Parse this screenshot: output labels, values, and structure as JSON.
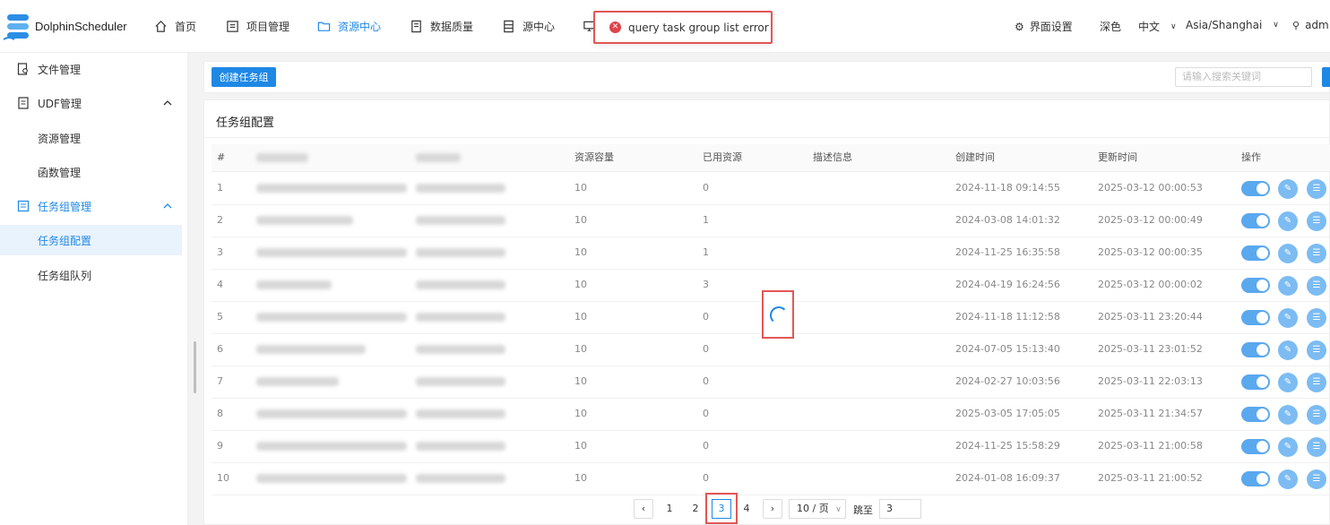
{
  "header": {
    "brand": "DolphinScheduler",
    "nav": [
      {
        "label": "首页",
        "icon": "home-icon"
      },
      {
        "label": "项目管理",
        "icon": "project-icon"
      },
      {
        "label": "资源中心",
        "icon": "folder-icon",
        "active": true
      },
      {
        "label": "数据质量",
        "icon": "quality-icon"
      },
      {
        "label": "源中心",
        "icon": "datasource-icon"
      },
      {
        "label": "",
        "icon": "monitor-icon"
      }
    ],
    "toast": {
      "text": "query task group list error"
    },
    "settings_label": "界面设置",
    "theme_label": "深色",
    "lang_label": "中文",
    "timezone_label": "Asia/Shanghai",
    "user_label": "adm"
  },
  "sidebar": {
    "items": [
      {
        "label": "文件管理"
      },
      {
        "label": "UDF管理"
      },
      {
        "label": "资源管理"
      },
      {
        "label": "函数管理"
      },
      {
        "label": "任务组管理"
      },
      {
        "label": "任务组配置"
      },
      {
        "label": "任务组队列"
      }
    ]
  },
  "toolbar": {
    "create_label": "创建任务组",
    "search_placeholder": "请输入搜索关键词"
  },
  "card": {
    "title": "任务组配置"
  },
  "table": {
    "headers": [
      "#",
      "",
      "",
      "资源容量",
      "已用资源",
      "描述信息",
      "创建时间",
      "更新时间",
      "操作"
    ],
    "rows": [
      {
        "idx": "1",
        "capacity": "10",
        "used": "0",
        "created": "2024-11-18 09:14:55",
        "updated": "2025-03-12 00:00:53"
      },
      {
        "idx": "2",
        "capacity": "10",
        "used": "1",
        "created": "2024-03-08 14:01:32",
        "updated": "2025-03-12 00:00:49"
      },
      {
        "idx": "3",
        "capacity": "10",
        "used": "1",
        "created": "2024-11-25 16:35:58",
        "updated": "2025-03-12 00:00:35"
      },
      {
        "idx": "4",
        "capacity": "10",
        "used": "3",
        "created": "2024-04-19 16:24:56",
        "updated": "2025-03-12 00:00:02"
      },
      {
        "idx": "5",
        "capacity": "10",
        "used": "0",
        "created": "2024-11-18 11:12:58",
        "updated": "2025-03-11 23:20:44"
      },
      {
        "idx": "6",
        "capacity": "10",
        "used": "0",
        "created": "2024-07-05 15:13:40",
        "updated": "2025-03-11 23:01:52"
      },
      {
        "idx": "7",
        "capacity": "10",
        "used": "0",
        "created": "2024-02-27 10:03:56",
        "updated": "2025-03-11 22:03:13"
      },
      {
        "idx": "8",
        "capacity": "10",
        "used": "0",
        "created": "2025-03-05 17:05:05",
        "updated": "2025-03-11 21:34:57"
      },
      {
        "idx": "9",
        "capacity": "10",
        "used": "0",
        "created": "2024-11-25 15:58:29",
        "updated": "2025-03-11 21:00:58"
      },
      {
        "idx": "10",
        "capacity": "10",
        "used": "0",
        "created": "2024-01-08 16:09:37",
        "updated": "2025-03-11 21:00:52"
      }
    ]
  },
  "pagination": {
    "pages": [
      "1",
      "2",
      "3",
      "4"
    ],
    "current": "3",
    "page_size": "10 / 页",
    "jump_label": "跳至",
    "jump_value": "3"
  },
  "colors": {
    "primary": "#1e88e5",
    "error": "#e0434a",
    "highlight": "#e35656"
  }
}
